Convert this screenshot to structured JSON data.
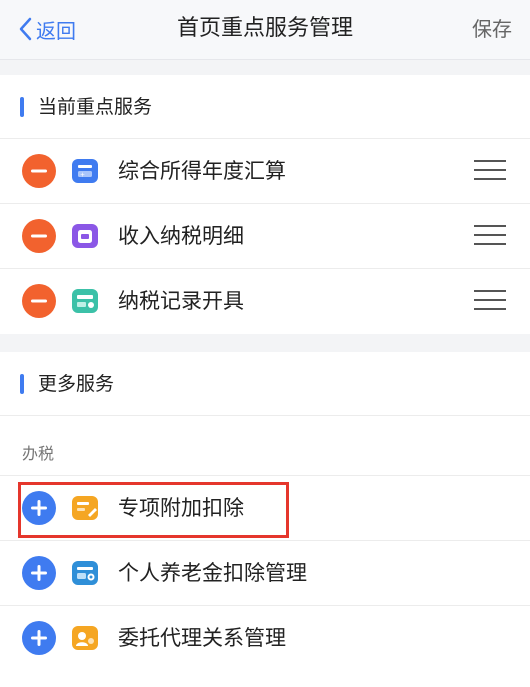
{
  "nav": {
    "back_label": "返回",
    "title": "首页重点服务管理",
    "save_label": "保存"
  },
  "current": {
    "title": "当前重点服务",
    "items": [
      {
        "label": "综合所得年度汇算",
        "icon": "annual-settlement-icon",
        "icon_color": "#3f7bf0"
      },
      {
        "label": "收入纳税明细",
        "icon": "income-tax-detail-icon",
        "icon_color": "#8b57e6"
      },
      {
        "label": "纳税记录开具",
        "icon": "tax-record-icon",
        "icon_color": "#3cc1a8"
      }
    ]
  },
  "more": {
    "title": "更多服务",
    "group_label": "办税",
    "items": [
      {
        "label": "专项附加扣除",
        "icon": "special-deduction-icon",
        "icon_color": "#f5a623"
      },
      {
        "label": "个人养老金扣除管理",
        "icon": "pension-deduction-icon",
        "icon_color": "#2f8fd8"
      },
      {
        "label": "委托代理关系管理",
        "icon": "agency-relation-icon",
        "icon_color": "#f5a623"
      }
    ]
  },
  "colors": {
    "accent": "#3f7bf0",
    "remove": "#f2622e",
    "add": "#3f7bf0",
    "highlight": "#e5362c"
  }
}
